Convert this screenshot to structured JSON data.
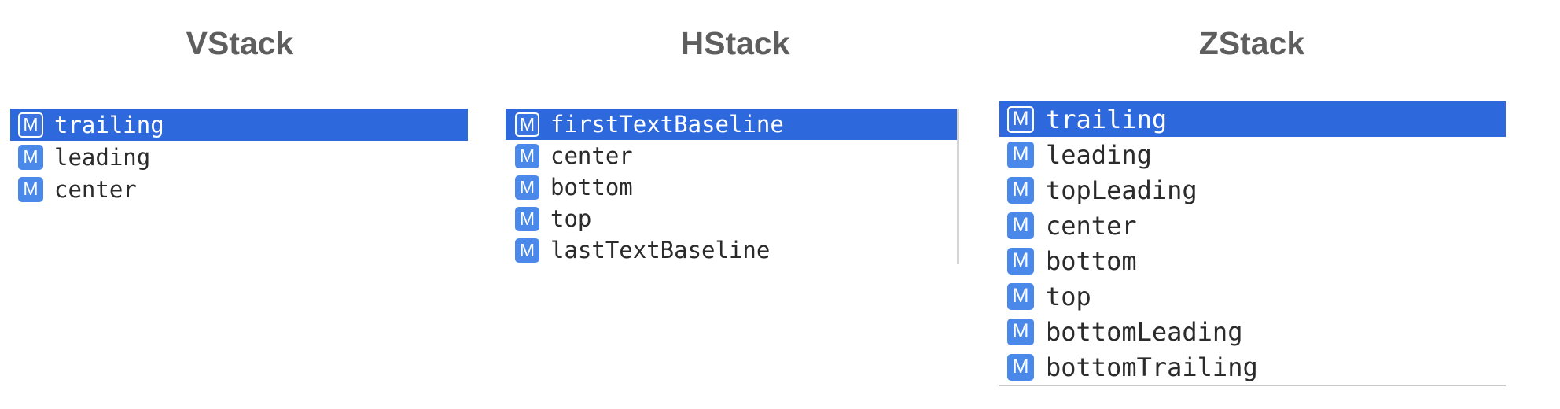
{
  "icon": {
    "glyph": "M",
    "name": "method-icon",
    "color": "#4a88ea"
  },
  "colors": {
    "selection": "#2d68dc",
    "title": "#5e5e5e"
  },
  "panels": {
    "vstack": {
      "title": "VStack",
      "items": [
        {
          "label": "trailing",
          "selected": true
        },
        {
          "label": "leading",
          "selected": false
        },
        {
          "label": "center",
          "selected": false
        }
      ]
    },
    "hstack": {
      "title": "HStack",
      "items": [
        {
          "label": "firstTextBaseline",
          "selected": true
        },
        {
          "label": "center",
          "selected": false
        },
        {
          "label": "bottom",
          "selected": false
        },
        {
          "label": "top",
          "selected": false
        },
        {
          "label": "lastTextBaseline",
          "selected": false
        }
      ]
    },
    "zstack": {
      "title": "ZStack",
      "items": [
        {
          "label": "trailing",
          "selected": true
        },
        {
          "label": "leading",
          "selected": false
        },
        {
          "label": "topLeading",
          "selected": false
        },
        {
          "label": "center",
          "selected": false
        },
        {
          "label": "bottom",
          "selected": false
        },
        {
          "label": "top",
          "selected": false
        },
        {
          "label": "bottomLeading",
          "selected": false
        },
        {
          "label": "bottomTrailing",
          "selected": false
        }
      ]
    }
  }
}
